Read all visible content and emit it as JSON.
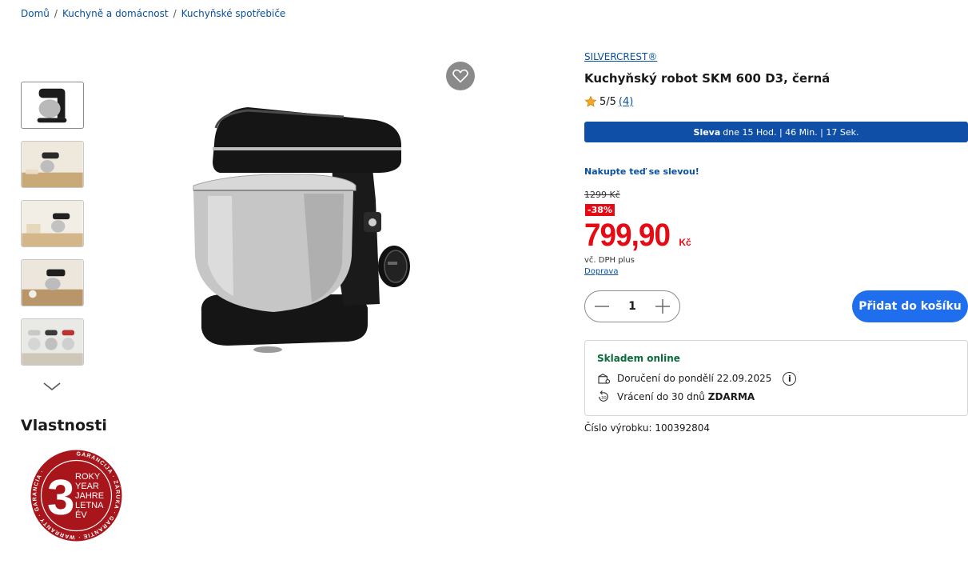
{
  "breadcrumb": {
    "home": "Domů",
    "cat1": "Kuchyně a domácnost",
    "cat2": "Kuchyňské spotřebiče",
    "sep": "/"
  },
  "product": {
    "brand": "SILVERCREST®",
    "title": "Kuchyňský robot SKM 600 D3, černá",
    "rating": "5/5",
    "rating_count": "(4)",
    "sale_prefix": "Sleva",
    "sale_timer": "dne 15 Hod. | 46 Min. | 17 Sek.",
    "promo": "Nakupte teď se slevou!",
    "old_price": "1299 Kč",
    "discount": "-38%",
    "price_int": "799,",
    "price_dec": "90",
    "currency": "Kč",
    "vat": "vč. DPH plus",
    "shipping_link": "Doprava",
    "quantity": "1",
    "add_to_cart": "Přidat do košíku",
    "stock": "Skladem online",
    "delivery": "Doručení do pondělí 22.09.2025",
    "return_text": "Vrácení do 30 dnů",
    "return_free": "ZDARMA",
    "product_number": "Číslo výrobku: 100392804"
  },
  "properties": {
    "heading": "Vlastnosti",
    "warranty_number": "3",
    "warranty_words": [
      "ROKY",
      "YEAR",
      "JAHRE",
      "LETNA",
      "ÉV"
    ],
    "warranty_ring": "GARANCIJA · ZÁRUKA · GARANTIE · WARRANTY · GARANCIA"
  },
  "colors": {
    "link_blue": "#0a50a1",
    "sale_bar": "#0f4fa8",
    "price_red": "#e60a14",
    "cart_button": "#1e6eee",
    "stock_green": "#0b6b3a",
    "badge_red": "#a8161b"
  }
}
